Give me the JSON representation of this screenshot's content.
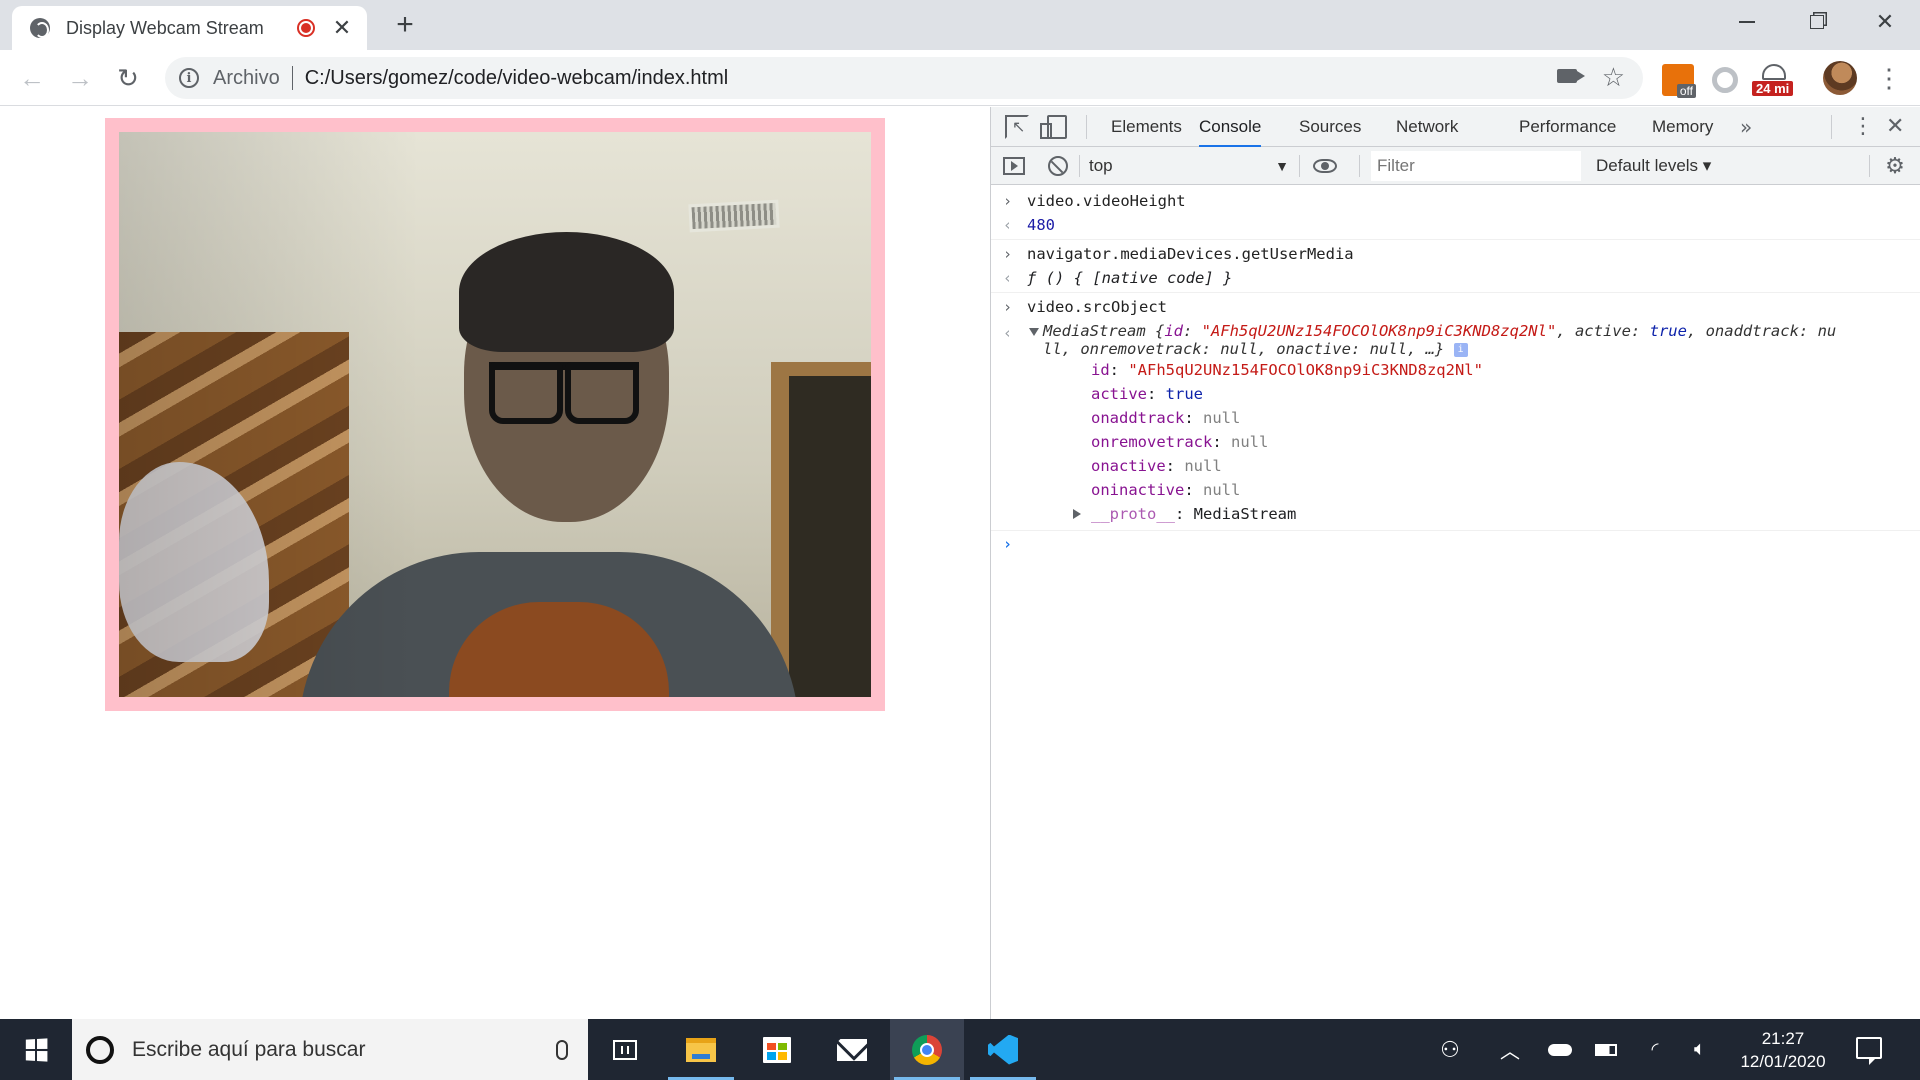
{
  "browser": {
    "tab_title": "Display Webcam Stream",
    "tab_close": "✕",
    "new_tab": "+",
    "origin_chip": "Archivo",
    "url": "C:/Users/gomez/code/video-webcam/index.html",
    "extensions": {
      "off_badge": "off",
      "weather_badge": "24 mi"
    }
  },
  "devtools": {
    "tabs": [
      "Elements",
      "Console",
      "Sources",
      "Network",
      "Performance",
      "Memory"
    ],
    "active_tab": "Console",
    "more_tabs": "»",
    "context": "top",
    "filter_placeholder": "Filter",
    "levels": "Default levels ▾",
    "console": [
      {
        "type": "input",
        "text": "video.videoHeight"
      },
      {
        "type": "result",
        "text": "480"
      },
      {
        "type": "input",
        "text": "navigator.mediaDevices.getUserMedia"
      },
      {
        "type": "result",
        "text": "ƒ () { [native code] }"
      },
      {
        "type": "input",
        "text": "video.srcObject"
      }
    ],
    "mediastream": {
      "class": "MediaStream",
      "id": "\"AFh5qU2UNz154FOCOlOK8np9iC3KND8zq2Nl\"",
      "summary_rest_1": ", active: ",
      "summary_true": "true",
      "summary_rest_2": ", onaddtrack: nu",
      "summary_line2": "ll, onremovetrack: null, onactive: null, …}",
      "info_badge": "i",
      "props": [
        {
          "key": "id",
          "value": "\"AFh5qU2UNz154FOCOlOK8np9iC3KND8zq2Nl\"",
          "kind": "string"
        },
        {
          "key": "active",
          "value": "true",
          "kind": "keyword"
        },
        {
          "key": "onaddtrack",
          "value": "null",
          "kind": "null"
        },
        {
          "key": "onremovetrack",
          "value": "null",
          "kind": "null"
        },
        {
          "key": "onactive",
          "value": "null",
          "kind": "null"
        },
        {
          "key": "oninactive",
          "value": "null",
          "kind": "null"
        }
      ],
      "proto_key": "__proto__",
      "proto_value": "MediaStream"
    }
  },
  "taskbar": {
    "search_placeholder": "Escribe aquí para buscar",
    "time": "21:27",
    "date": "12/01/2020"
  },
  "colors": {
    "video_frame": "#ffc0cb",
    "devtools_active_tab": "#1a73e8",
    "taskbar_bg": "#1f2632"
  }
}
